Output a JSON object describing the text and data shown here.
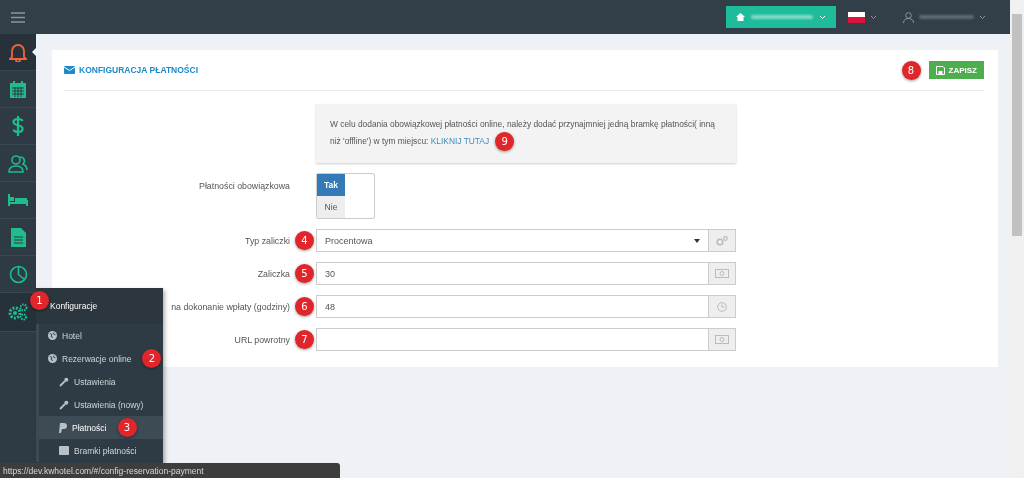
{
  "sidebar": {
    "items": [
      {
        "selected": true
      },
      {
        "selected": false
      },
      {
        "selected": false
      },
      {
        "selected": false
      },
      {
        "selected": false
      },
      {
        "selected": false
      },
      {
        "selected": false
      },
      {
        "selected": false,
        "badge": "1"
      }
    ]
  },
  "flyout": {
    "title": "Konfiguracje",
    "items": [
      {
        "label": "Hotel",
        "selected": false
      },
      {
        "label": "Rezerwacje online",
        "selected": false,
        "badge": "2",
        "children": [
          {
            "label": "Ustawienia",
            "selected": false
          },
          {
            "label": "Ustawienia (nowy)",
            "selected": false
          },
          {
            "label": "Płatności",
            "selected": true,
            "badge": "3"
          },
          {
            "label": "Bramki płatności",
            "selected": false
          }
        ]
      }
    ]
  },
  "panel": {
    "title": "KONFIGURACJA PŁATNOŚCI",
    "save_button": "ZAPISZ",
    "save_badge": "8",
    "notice": {
      "text": "W celu dodania obowiązkowej płatności online, należy dodać przynajmniej jedną bramkę płatności( inną niż 'offline') w tym miejscu:",
      "link": "KLIKNIJ TUTAJ",
      "badge": "9"
    },
    "fields": [
      {
        "kind": "toggle",
        "label": "Płatności obowiązkowa",
        "options": [
          {
            "label": "Tak",
            "selected": true
          },
          {
            "label": "Nie",
            "selected": false
          }
        ]
      },
      {
        "kind": "select",
        "label": "Typ zaliczki",
        "badge": "4",
        "value": "Procentowa"
      },
      {
        "kind": "input",
        "label": "Zaliczka",
        "badge": "5",
        "value": "30"
      },
      {
        "kind": "input",
        "label": "na dokonanie wpłaty (godziny)",
        "badge": "6",
        "value": "48"
      },
      {
        "kind": "input",
        "label": "URL powrotny",
        "badge": "7"
      }
    ]
  },
  "status_bar": {
    "url": "https://dev.kwhotel.com/#/config-reservation-payment"
  }
}
